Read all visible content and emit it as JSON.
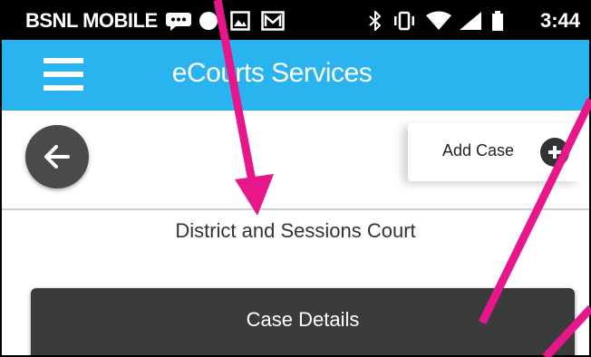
{
  "status_bar": {
    "carrier": "BSNL MOBILE",
    "time": "3:44",
    "icons": [
      "chat-icon",
      "circle-app-icon",
      "image-icon",
      "photo-icon",
      "bluetooth-icon",
      "vibrate-icon",
      "wifi-icon",
      "signal-icon",
      "battery-icon"
    ]
  },
  "app_bar": {
    "title": "eCourts Services",
    "menu_icon": "hamburger-menu-icon",
    "color": "#2ab4ef"
  },
  "toolbar": {
    "back_icon": "back-arrow-icon",
    "add_case_label": "Add Case",
    "add_case_icon": "plus-circle-icon"
  },
  "main": {
    "court_name": "District and Sessions Court",
    "case_details_label": "Case Details",
    "button_color": "#3b3b3b"
  },
  "annotation": {
    "arrow_color": "#e8168b"
  }
}
